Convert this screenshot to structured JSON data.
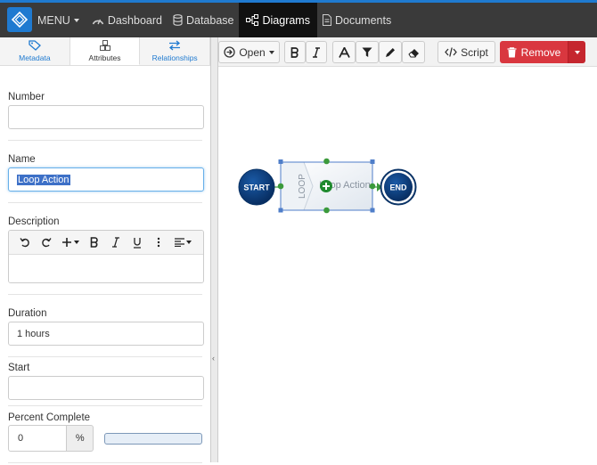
{
  "nav": {
    "menu_label": "MENU",
    "items": [
      {
        "label": "Dashboard",
        "icon": "dashboard-icon"
      },
      {
        "label": "Database",
        "icon": "database-icon"
      },
      {
        "label": "Diagrams",
        "icon": "diagram-icon",
        "active": true
      },
      {
        "label": "Documents",
        "icon": "document-icon"
      }
    ]
  },
  "tabs": [
    {
      "label": "Metadata",
      "icon": "tag-icon"
    },
    {
      "label": "Attributes",
      "icon": "cubes-icon",
      "active": true
    },
    {
      "label": "Relationships",
      "icon": "exchange-icon"
    }
  ],
  "form": {
    "number": {
      "label": "Number",
      "value": ""
    },
    "name": {
      "label": "Name",
      "value": "Loop Action"
    },
    "description": {
      "label": "Description",
      "value": ""
    },
    "duration": {
      "label": "Duration",
      "value": "1 hours"
    },
    "start": {
      "label": "Start",
      "value": ""
    },
    "percent": {
      "label": "Percent Complete",
      "value": "0",
      "unit": "%",
      "progress": 0
    }
  },
  "toolbar": {
    "open_label": "Open",
    "script_label": "Script",
    "remove_label": "Remove"
  },
  "diagram": {
    "start_label": "START",
    "end_label": "END",
    "loop_label": "LOOP",
    "action_label": "Loop Action"
  },
  "colors": {
    "accent": "#1f7ad0",
    "topbar": "#3a3a3a",
    "remove": "#d9373f",
    "node": "#0d3d7a",
    "handle": "#3b9a3b"
  }
}
